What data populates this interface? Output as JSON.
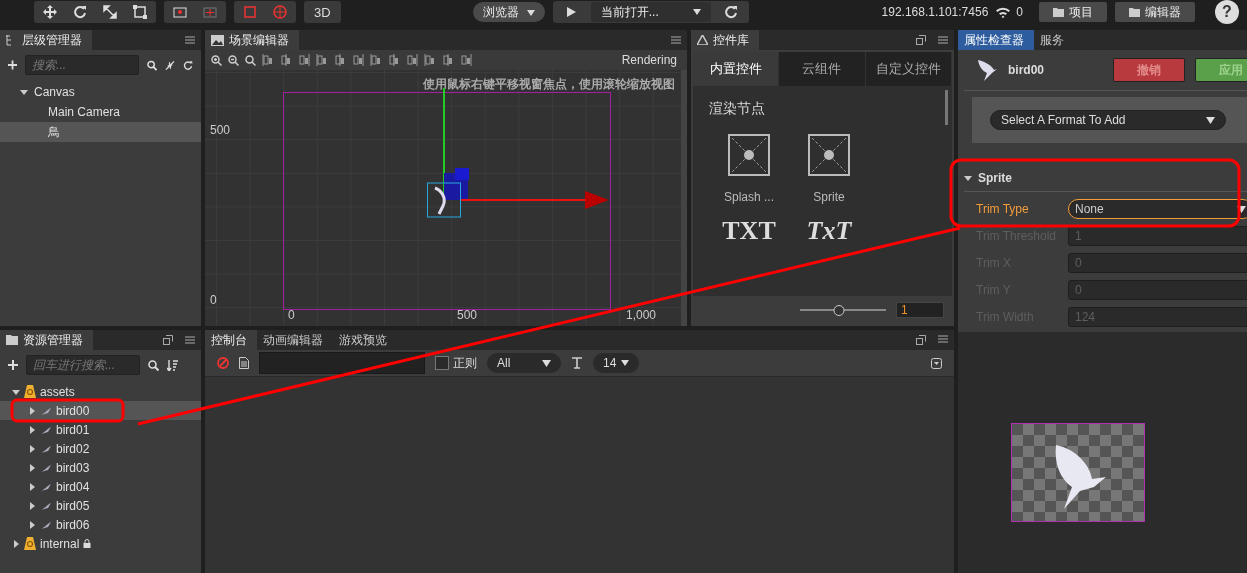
{
  "toolbar": {
    "view_button": "3D",
    "platform_select": "浏览器",
    "scene_select": "当前打开...",
    "address": "192.168.1.101:7456",
    "connections": "0",
    "buttons": [
      "项目",
      "编辑器"
    ],
    "help": "?"
  },
  "hierarchy": {
    "title": "层级管理器",
    "search": {
      "placeholder": "搜索..."
    },
    "tree": [
      {
        "label": "Canvas",
        "expanded": true,
        "selected": false,
        "children": [
          {
            "label": "Main Camera",
            "selected": false
          },
          {
            "label": "鳥",
            "selected": true
          }
        ]
      }
    ]
  },
  "scene": {
    "title": "场景编辑器",
    "mode": "Rendering",
    "hint": "使用鼠标右键平移视窗焦点，使用滚轮缩放视图",
    "y_labels": [
      "500",
      "0"
    ],
    "x_labels": [
      "0",
      "500",
      "1,000"
    ]
  },
  "library": {
    "title": "控件库",
    "tabs": [
      {
        "label": "内置控件",
        "selected": true
      },
      {
        "label": "云组件",
        "selected": false
      },
      {
        "label": "自定义控件",
        "selected": false
      }
    ],
    "section": "渲染节点",
    "items": [
      {
        "kind": "node",
        "label": "Splash ..."
      },
      {
        "kind": "node",
        "label": "Sprite"
      },
      {
        "kind": "text",
        "glyph": "TXT"
      },
      {
        "kind": "richtext",
        "glyph": "TxT"
      }
    ],
    "zoom": {
      "level": 0.45,
      "value": "1"
    }
  },
  "assets": {
    "title": "资源管理器",
    "search": {
      "placeholder": "回车进行搜索..."
    },
    "tree": [
      {
        "label": "assets",
        "expanded": true,
        "selected": false,
        "locked": false,
        "children": [
          {
            "label": "bird00",
            "expanded": false,
            "selected": true
          },
          {
            "label": "bird01",
            "expanded": false,
            "selected": false
          },
          {
            "label": "bird02",
            "expanded": false,
            "selected": false
          },
          {
            "label": "bird03",
            "expanded": false,
            "selected": false
          },
          {
            "label": "bird04",
            "expanded": false,
            "selected": false
          },
          {
            "label": "bird05",
            "expanded": false,
            "selected": false
          },
          {
            "label": "bird06",
            "expanded": false,
            "selected": false
          }
        ]
      },
      {
        "label": "internal",
        "expanded": false,
        "selected": false,
        "locked": true
      }
    ]
  },
  "console": {
    "tabs": [
      {
        "label": "控制台",
        "selected": true
      },
      {
        "label": "动画编辑器",
        "selected": false
      },
      {
        "label": "游戏预览",
        "selected": false
      }
    ],
    "regex": {
      "label": "正则",
      "checked": false
    },
    "level_select": "All",
    "font_size": "14"
  },
  "inspector": {
    "tabs": [
      {
        "label": "属性检查器",
        "selected": true
      },
      {
        "label": "服务",
        "selected": false
      }
    ],
    "node": "bird00",
    "buttons": [
      {
        "label": "撤销",
        "kind": "revert"
      },
      {
        "label": "应用",
        "kind": "apply"
      }
    ],
    "format_select": "Select A Format To Add",
    "component": {
      "title": "Sprite",
      "expanded": true,
      "props": [
        {
          "label": "Trim Type",
          "kind": "select",
          "value": "None",
          "focused": true,
          "disabled": false
        },
        {
          "label": "Trim Threshold",
          "kind": "number",
          "value": "1",
          "focused": false,
          "disabled": true
        },
        {
          "label": "Trim X",
          "kind": "number",
          "value": "0",
          "focused": false,
          "disabled": true
        },
        {
          "label": "Trim Y",
          "kind": "number",
          "value": "0",
          "focused": false,
          "disabled": true
        },
        {
          "label": "Trim Width",
          "kind": "number",
          "value": "124",
          "focused": false,
          "disabled": true
        }
      ]
    }
  }
}
